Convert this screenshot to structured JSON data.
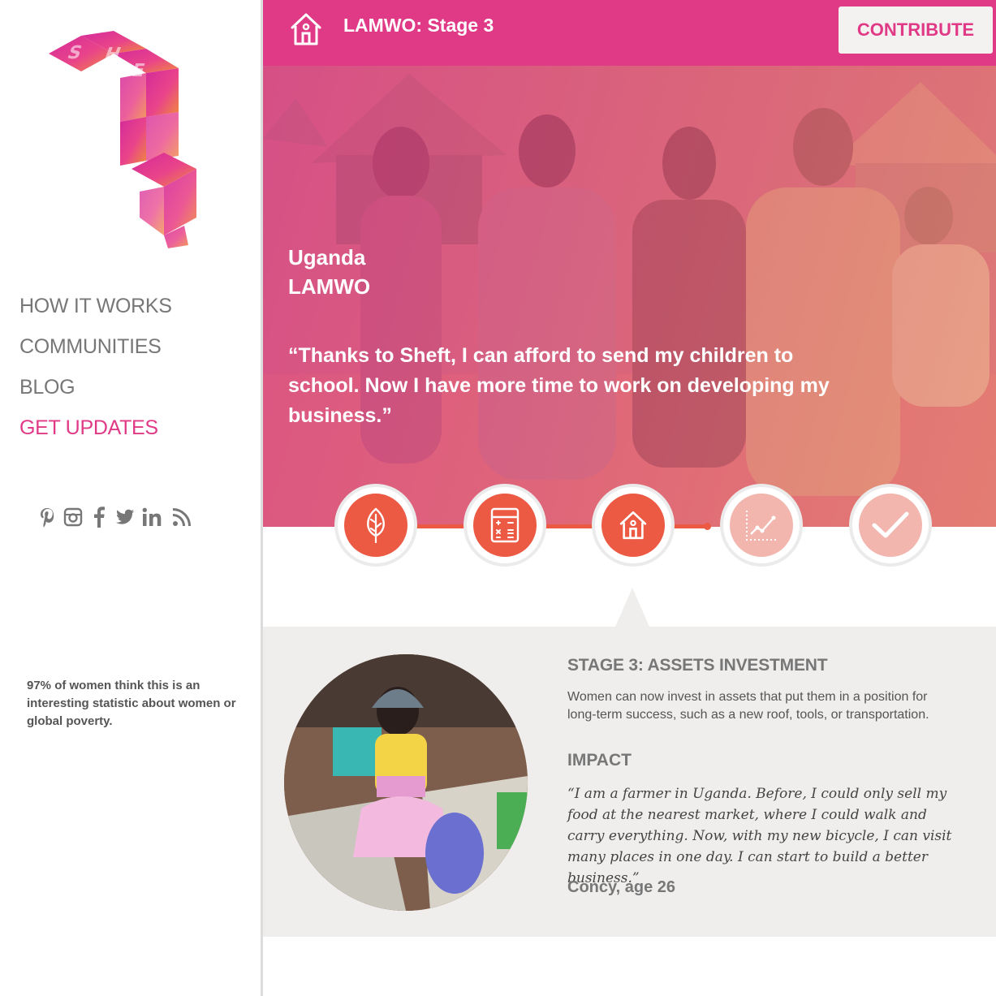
{
  "brand": {
    "logo_text": "SHEFT",
    "accent_color": "#e03a87",
    "stage_color": "#ec5a44"
  },
  "nav": {
    "items": [
      {
        "label": "HOW IT WORKS"
      },
      {
        "label": "COMMUNITIES"
      },
      {
        "label": "BLOG"
      },
      {
        "label": "GET UPDATES"
      }
    ]
  },
  "social": [
    "pinterest-icon",
    "instagram-icon",
    "facebook-icon",
    "twitter-icon",
    "linkedin-icon",
    "rss-icon"
  ],
  "sidebar": {
    "stat": "97% of women think this is an interesting statistic about women or global poverty."
  },
  "header": {
    "title": "LAMWO: Stage 3",
    "contribute_label": "CONTRIBUTE"
  },
  "hero": {
    "country": "Uganda",
    "community": "LAMWO",
    "quote": "“Thanks to Sheft, I can afford to send my children to school. Now I have more time to work on developing my business.”"
  },
  "stages": [
    {
      "icon": "sprout-icon",
      "status": "completed"
    },
    {
      "icon": "calculator-icon",
      "status": "completed"
    },
    {
      "icon": "home-icon",
      "status": "current"
    },
    {
      "icon": "growth-chart-icon",
      "status": "upcoming"
    },
    {
      "icon": "checkmark-icon",
      "status": "upcoming"
    }
  ],
  "detail": {
    "stage_title": "STAGE 3: ASSETS INVESTMENT",
    "stage_description": "Women can now invest in assets that put them in a position for long-term success, such as a new roof, tools, or transportation.",
    "impact_title": "IMPACT",
    "impact_quote": "“I am a farmer in Uganda. Before, I could only sell my food at the nearest market, where I could walk and carry everything. Now, with my new bicycle, I can visit many places in one day. I can start to build a better business.”",
    "impact_author": "Concy, age 26"
  }
}
